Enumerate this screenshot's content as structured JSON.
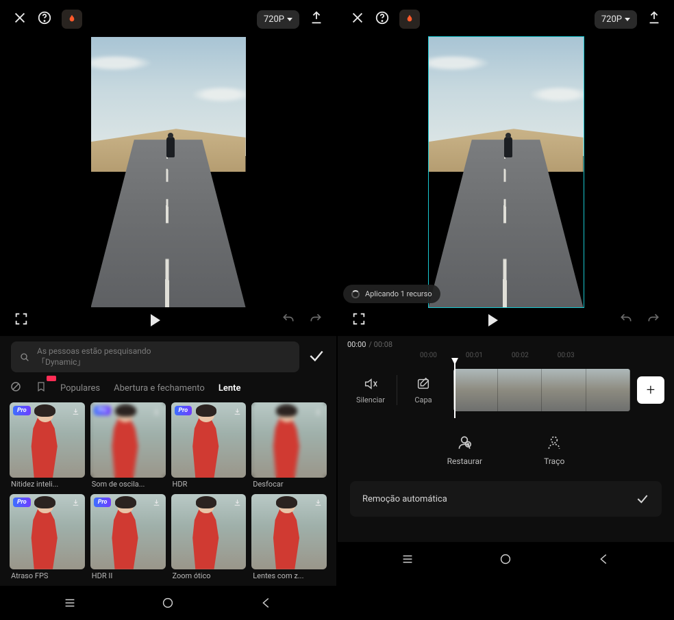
{
  "header": {
    "resolution": "720P"
  },
  "left": {
    "search_placeholder": "As pessoas estão pesquisando\n「Dynamic」",
    "tabs": {
      "populares": "Populares",
      "abertura": "Abertura e fechamento",
      "lente": "Lente"
    },
    "effects_row1": [
      {
        "label": "Nitidez inteli...",
        "pro": true,
        "dl": true
      },
      {
        "label": "Som de oscila...",
        "pro": true,
        "dl": true
      },
      {
        "label": "HDR",
        "pro": true,
        "dl": true
      },
      {
        "label": "Desfocar",
        "pro": false,
        "dl": true
      }
    ],
    "effects_row2": [
      {
        "label": "Atraso FPS",
        "pro": true,
        "dl": true
      },
      {
        "label": "HDR II",
        "pro": true,
        "dl": true
      },
      {
        "label": "Zoom ótico",
        "pro": false,
        "dl": true
      },
      {
        "label": "Lentes com z...",
        "pro": false,
        "dl": true
      }
    ]
  },
  "right": {
    "status_text": "Aplicando 1 recurso",
    "time_current": "00:00",
    "time_total": "/ 00:08",
    "ruler": [
      "00:00",
      "00:01",
      "00:02",
      "00:03"
    ],
    "track_buttons": {
      "mute": "Silenciar",
      "cover": "Capa"
    },
    "actions": {
      "restore": "Restaurar",
      "stroke": "Traço"
    },
    "auto_remove_label": "Remoção automática"
  }
}
